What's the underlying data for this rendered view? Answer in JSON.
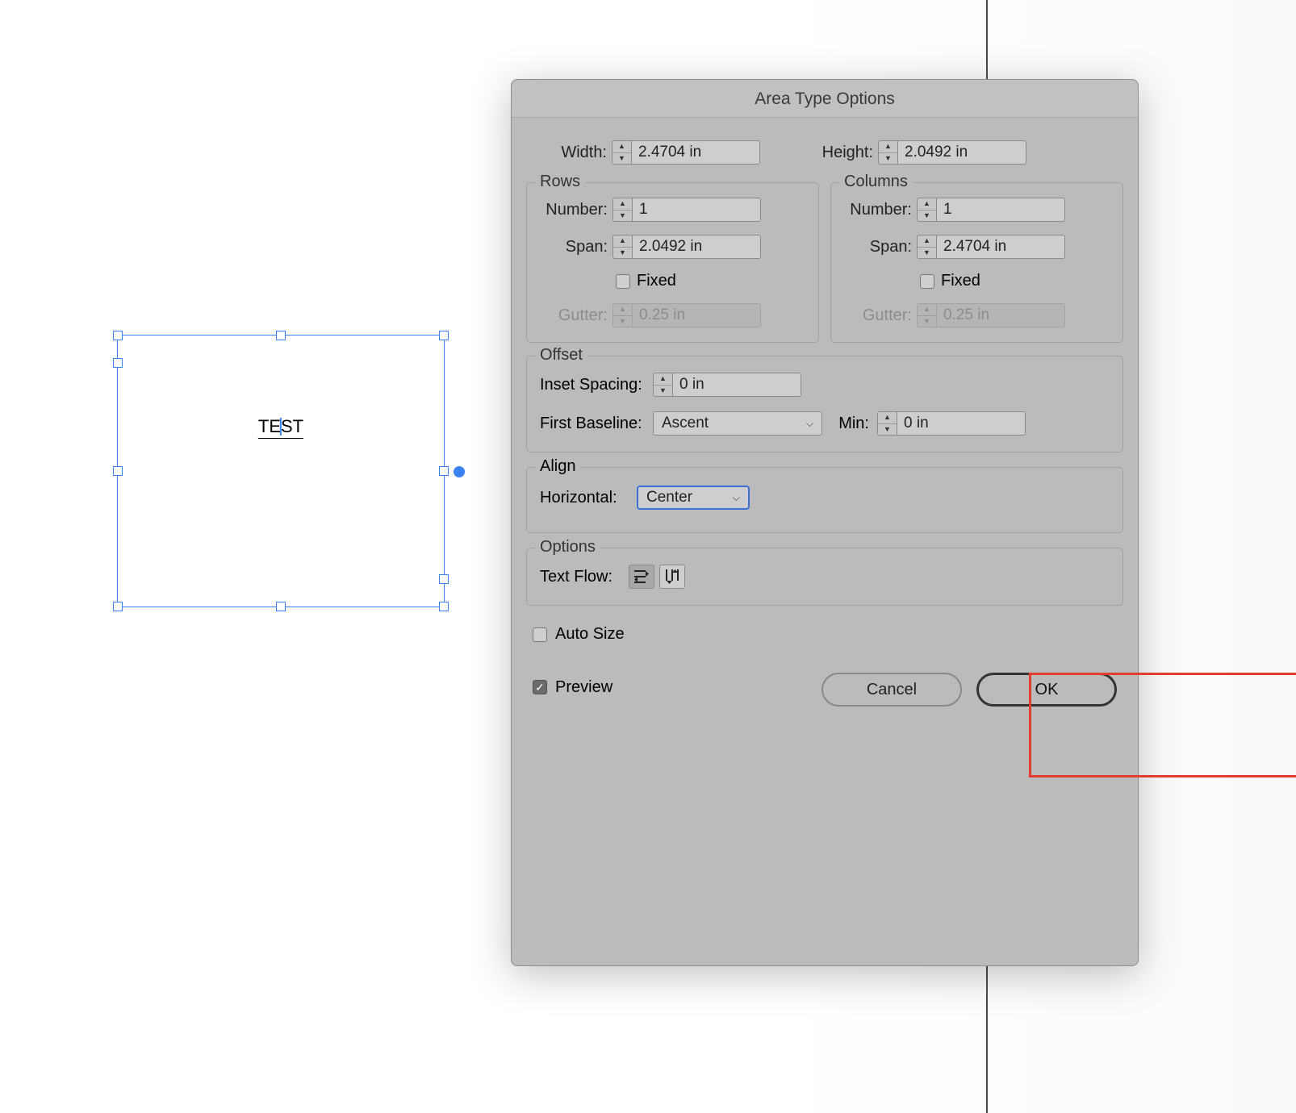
{
  "canvas": {
    "text": "TEST",
    "text_parts": {
      "before": "TE",
      "after": "ST"
    }
  },
  "dialog": {
    "title": "Area Type Options",
    "width_label": "Width:",
    "width_value": "2.4704 in",
    "height_label": "Height:",
    "height_value": "2.0492 in",
    "rows": {
      "legend": "Rows",
      "number_label": "Number:",
      "number_value": "1",
      "span_label": "Span:",
      "span_value": "2.0492 in",
      "fixed_label": "Fixed",
      "fixed_checked": false,
      "gutter_label": "Gutter:",
      "gutter_value": "0.25 in"
    },
    "columns": {
      "legend": "Columns",
      "number_label": "Number:",
      "number_value": "1",
      "span_label": "Span:",
      "span_value": "2.4704 in",
      "fixed_label": "Fixed",
      "fixed_checked": false,
      "gutter_label": "Gutter:",
      "gutter_value": "0.25 in"
    },
    "offset": {
      "legend": "Offset",
      "inset_label": "Inset Spacing:",
      "inset_value": "0 in",
      "first_baseline_label": "First Baseline:",
      "first_baseline_value": "Ascent",
      "min_label": "Min:",
      "min_value": "0 in"
    },
    "align": {
      "legend": "Align",
      "horizontal_label": "Horizontal:",
      "horizontal_value": "Center"
    },
    "options": {
      "legend": "Options",
      "textflow_label": "Text Flow:"
    },
    "auto_size_label": "Auto Size",
    "auto_size_checked": false,
    "preview_label": "Preview",
    "preview_checked": true,
    "cancel_label": "Cancel",
    "ok_label": "OK"
  }
}
